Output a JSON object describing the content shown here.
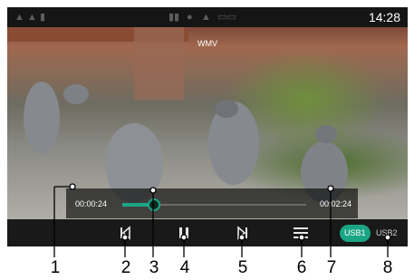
{
  "status_bar": {
    "time": "14:28",
    "left_icons": [
      "signal-icon",
      "signal-icon",
      "signal-icon"
    ],
    "center_icons": [
      "radio-icon",
      "mic-icon",
      "network-icon",
      "battery-icon"
    ]
  },
  "video": {
    "format": "WMV"
  },
  "progress": {
    "current_time": "00:00:24",
    "total_time": "00:02:24",
    "fraction": 0.17
  },
  "controls": {
    "previous_icon": "skip-previous-icon",
    "pause_icon": "pause-icon",
    "next_icon": "skip-next-icon",
    "playlist_icon": "playlist-icon"
  },
  "sources": {
    "usb1_label": "USB1",
    "usb2_label": "USB2",
    "active": "USB1"
  },
  "callouts": [
    {
      "number": "1"
    },
    {
      "number": "2"
    },
    {
      "number": "3"
    },
    {
      "number": "4"
    },
    {
      "number": "5"
    },
    {
      "number": "6"
    },
    {
      "number": "7"
    },
    {
      "number": "8"
    }
  ],
  "colors": {
    "accent": "#1aa584",
    "bar_background": "#151515",
    "callout_text": "#000000"
  }
}
